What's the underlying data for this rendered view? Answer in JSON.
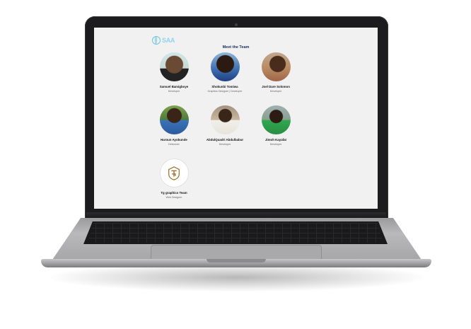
{
  "site": {
    "logo_text": "SAA",
    "brand_color": "#6fc5e8"
  },
  "page": {
    "title": "Meet the Team"
  },
  "team": [
    {
      "name": "Samuel Bamigboye",
      "role": "Developer",
      "avatar": "photo-avatar"
    },
    {
      "name": "Shokunbi Tomiwa",
      "role": "Graphics Designer | Developer",
      "avatar": "photo-avatar"
    },
    {
      "name": "Joel Dare Solomon",
      "role": "Developer",
      "avatar": "photo-avatar"
    },
    {
      "name": "Haroun Ayobunde",
      "role": "Debonner",
      "avatar": "photo-avatar"
    },
    {
      "name": "AbdulQuadri Abdulbabur",
      "role": "Developer",
      "avatar": "photo-avatar"
    },
    {
      "name": "Jimoh Kayafat",
      "role": "Developer",
      "avatar": "photo-avatar"
    },
    {
      "name": "Tg graphics Team",
      "role": "Web Designer",
      "avatar": "tg-logo-icon"
    }
  ],
  "colors": {
    "page_background": "#f1f1f1",
    "title_color": "#1c2e5a",
    "tg_logo_color": "#a0783c"
  }
}
